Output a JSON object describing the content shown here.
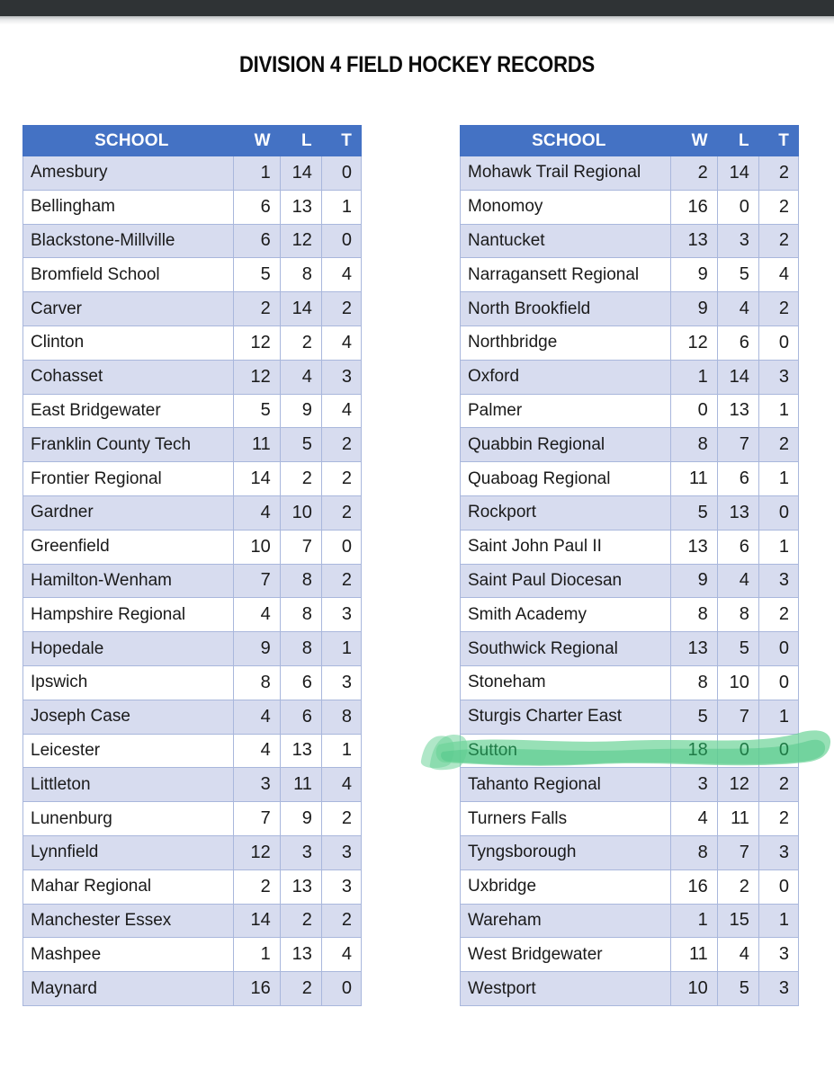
{
  "window": {
    "top_bar_color": "#2f3335",
    "page_background": "#ffffff"
  },
  "page": {
    "title": "DIVISION 4 FIELD HOCKEY RECORDS"
  },
  "theme": {
    "header_blue": "#4472c4",
    "row_tint": "#d7dcef",
    "border_blue": "#a9b7dc",
    "highlight_green": "#6fd49a",
    "highlight_text_green": "#1f7a46"
  },
  "columns": {
    "school": "SCHOOL",
    "w": "W",
    "l": "L",
    "t": "T"
  },
  "tables": [
    {
      "id": "left",
      "rows": [
        {
          "school": "Amesbury",
          "w": "1",
          "l": "14",
          "t": "0",
          "highlighted": false
        },
        {
          "school": "Bellingham",
          "w": "6",
          "l": "13",
          "t": "1",
          "highlighted": false
        },
        {
          "school": "Blackstone-Millville",
          "w": "6",
          "l": "12",
          "t": "0",
          "highlighted": false
        },
        {
          "school": "Bromfield School",
          "w": "5",
          "l": "8",
          "t": "4",
          "highlighted": false
        },
        {
          "school": "Carver",
          "w": "2",
          "l": "14",
          "t": "2",
          "highlighted": false
        },
        {
          "school": "Clinton",
          "w": "12",
          "l": "2",
          "t": "4",
          "highlighted": false
        },
        {
          "school": "Cohasset",
          "w": "12",
          "l": "4",
          "t": "3",
          "highlighted": false
        },
        {
          "school": "East Bridgewater",
          "w": "5",
          "l": "9",
          "t": "4",
          "highlighted": false
        },
        {
          "school": "Franklin County Tech",
          "w": "11",
          "l": "5",
          "t": "2",
          "highlighted": false
        },
        {
          "school": "Frontier Regional",
          "w": "14",
          "l": "2",
          "t": "2",
          "highlighted": false
        },
        {
          "school": "Gardner",
          "w": "4",
          "l": "10",
          "t": "2",
          "highlighted": false
        },
        {
          "school": "Greenfield",
          "w": "10",
          "l": "7",
          "t": "0",
          "highlighted": false
        },
        {
          "school": "Hamilton-Wenham",
          "w": "7",
          "l": "8",
          "t": "2",
          "highlighted": false
        },
        {
          "school": "Hampshire Regional",
          "w": "4",
          "l": "8",
          "t": "3",
          "highlighted": false
        },
        {
          "school": "Hopedale",
          "w": "9",
          "l": "8",
          "t": "1",
          "highlighted": false
        },
        {
          "school": "Ipswich",
          "w": "8",
          "l": "6",
          "t": "3",
          "highlighted": false
        },
        {
          "school": "Joseph Case",
          "w": "4",
          "l": "6",
          "t": "8",
          "highlighted": false
        },
        {
          "school": "Leicester",
          "w": "4",
          "l": "13",
          "t": "1",
          "highlighted": false
        },
        {
          "school": "Littleton",
          "w": "3",
          "l": "11",
          "t": "4",
          "highlighted": false
        },
        {
          "school": "Lunenburg",
          "w": "7",
          "l": "9",
          "t": "2",
          "highlighted": false
        },
        {
          "school": "Lynnfield",
          "w": "12",
          "l": "3",
          "t": "3",
          "highlighted": false
        },
        {
          "school": "Mahar Regional",
          "w": "2",
          "l": "13",
          "t": "3",
          "highlighted": false
        },
        {
          "school": "Manchester Essex",
          "w": "14",
          "l": "2",
          "t": "2",
          "highlighted": false
        },
        {
          "school": "Mashpee",
          "w": "1",
          "l": "13",
          "t": "4",
          "highlighted": false
        },
        {
          "school": "Maynard",
          "w": "16",
          "l": "2",
          "t": "0",
          "highlighted": false
        }
      ]
    },
    {
      "id": "right",
      "rows": [
        {
          "school": "Mohawk Trail Regional",
          "w": "2",
          "l": "14",
          "t": "2",
          "highlighted": false
        },
        {
          "school": "Monomoy",
          "w": "16",
          "l": "0",
          "t": "2",
          "highlighted": false
        },
        {
          "school": "Nantucket",
          "w": "13",
          "l": "3",
          "t": "2",
          "highlighted": false
        },
        {
          "school": "Narragansett Regional",
          "w": "9",
          "l": "5",
          "t": "4",
          "highlighted": false
        },
        {
          "school": "North Brookfield",
          "w": "9",
          "l": "4",
          "t": "2",
          "highlighted": false
        },
        {
          "school": "Northbridge",
          "w": "12",
          "l": "6",
          "t": "0",
          "highlighted": false
        },
        {
          "school": "Oxford",
          "w": "1",
          "l": "14",
          "t": "3",
          "highlighted": false
        },
        {
          "school": "Palmer",
          "w": "0",
          "l": "13",
          "t": "1",
          "highlighted": false
        },
        {
          "school": "Quabbin Regional",
          "w": "8",
          "l": "7",
          "t": "2",
          "highlighted": false
        },
        {
          "school": "Quaboag Regional",
          "w": "11",
          "l": "6",
          "t": "1",
          "highlighted": false
        },
        {
          "school": "Rockport",
          "w": "5",
          "l": "13",
          "t": "0",
          "highlighted": false
        },
        {
          "school": "Saint John Paul II",
          "w": "13",
          "l": "6",
          "t": "1",
          "highlighted": false
        },
        {
          "school": "Saint Paul Diocesan",
          "w": "9",
          "l": "4",
          "t": "3",
          "highlighted": false
        },
        {
          "school": "Smith Academy",
          "w": "8",
          "l": "8",
          "t": "2",
          "highlighted": false
        },
        {
          "school": "Southwick Regional",
          "w": "13",
          "l": "5",
          "t": "0",
          "highlighted": false
        },
        {
          "school": "Stoneham",
          "w": "8",
          "l": "10",
          "t": "0",
          "highlighted": false
        },
        {
          "school": "Sturgis Charter East",
          "w": "5",
          "l": "7",
          "t": "1",
          "highlighted": false
        },
        {
          "school": "Sutton",
          "w": "18",
          "l": "0",
          "t": "0",
          "highlighted": true
        },
        {
          "school": "Tahanto Regional",
          "w": "3",
          "l": "12",
          "t": "2",
          "highlighted": false
        },
        {
          "school": "Turners Falls",
          "w": "4",
          "l": "11",
          "t": "2",
          "highlighted": false
        },
        {
          "school": "Tyngsborough",
          "w": "8",
          "l": "7",
          "t": "3",
          "highlighted": false
        },
        {
          "school": "Uxbridge",
          "w": "16",
          "l": "2",
          "t": "0",
          "highlighted": false
        },
        {
          "school": "Wareham",
          "w": "1",
          "l": "15",
          "t": "1",
          "highlighted": false
        },
        {
          "school": "West Bridgewater",
          "w": "11",
          "l": "4",
          "t": "3",
          "highlighted": false
        },
        {
          "school": "Westport",
          "w": "10",
          "l": "5",
          "t": "3",
          "highlighted": false
        }
      ]
    }
  ]
}
